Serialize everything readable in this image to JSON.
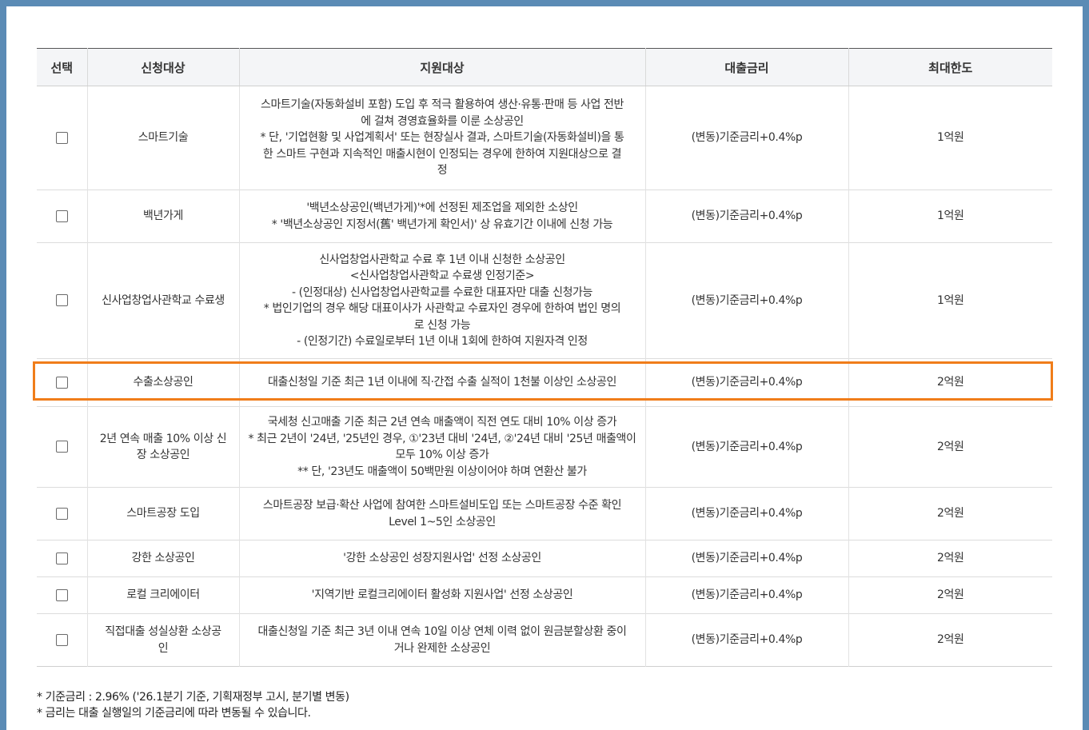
{
  "table": {
    "headers": {
      "select": "선택",
      "target": "신청대상",
      "support": "지원대상",
      "rate": "대출금리",
      "limit": "최대한도"
    },
    "rows": [
      {
        "target": [
          "스마트기술"
        ],
        "support": [
          "스마트기술(자동화설비 포함) 도입 후 적극 활용하여 생산·유통·판매 등 사업 전반",
          "에 걸쳐 경영효율화를 이룬 소상공인",
          "* 단, '기업현황 및 사업계획서' 또는 현장실사 결과, 스마트기술(자동화설비)을 통",
          "한 스마트 구현과 지속적인 매출시현이 인정되는 경우에 한하여 지원대상으로 결",
          "정"
        ],
        "rate": "(변동)기준금리+0.4%p",
        "limit": "1억원"
      },
      {
        "target": [
          "백년가게"
        ],
        "support": [
          "'백년소상공인(백년가게)'*에 선정된 제조업을 제외한 소상인",
          "* '백년소상공인 지정서(舊' 백년가게 확인서)' 상 유효기간 이내에 신청 가능"
        ],
        "rate": "(변동)기준금리+0.4%p",
        "limit": "1억원"
      },
      {
        "target": [
          "신사업창업사관학교 수료생"
        ],
        "support": [
          "신사업창업사관학교 수료 후 1년 이내 신청한 소상공인",
          "<신사업창업사관학교 수료생 인정기준>",
          "- (인정대상) 신사업창업사관학교를 수료한 대표자만 대출 신청가능",
          "* 법인기업의 경우 해당 대표이사가 사관학교 수료자인 경우에 한하여 법인 명의",
          "로 신청 가능",
          "- (인정기간) 수료일로부터 1년 이내 1회에 한하여 지원자격 인정"
        ],
        "rate": "(변동)기준금리+0.4%p",
        "limit": "1억원"
      },
      {
        "target": [
          "수출소상공인"
        ],
        "support": [
          "대출신청일 기준 최근 1년 이내에 직·간접 수출 실적이 1천불 이상인 소상공인"
        ],
        "rate": "(변동)기준금리+0.4%p",
        "limit": "2억원"
      },
      {
        "target": [
          "2년 연속 매출 10% 이상 신",
          "장 소상공인"
        ],
        "support": [
          "국세청 신고매출 기준 최근 2년 연속 매출액이 직전 연도 대비 10% 이상 증가",
          "* 최근 2년이 '24년, '25년인 경우, ①'23년 대비 '24년, ②'24년 대비 '25년 매출액이",
          "모두 10% 이상 증가",
          "** 단, '23년도 매출액이 50백만원 이상이어야 하며 연환산 불가"
        ],
        "rate": "(변동)기준금리+0.4%p",
        "limit": "2억원"
      },
      {
        "target": [
          "스마트공장 도입"
        ],
        "support": [
          "스마트공장 보급·확산 사업에 참여한 스마트설비도입 또는 스마트공장 수준 확인",
          "Level 1~5인 소상공인"
        ],
        "rate": "(변동)기준금리+0.4%p",
        "limit": "2억원"
      },
      {
        "target": [
          "강한 소상공인"
        ],
        "support": [
          "'강한 소상공인 성장지원사업' 선정 소상공인"
        ],
        "rate": "(변동)기준금리+0.4%p",
        "limit": "2억원"
      },
      {
        "target": [
          "로컬 크리에이터"
        ],
        "support": [
          "'지역기반 로컬크리에이터 활성화 지원사업' 선정 소상공인"
        ],
        "rate": "(변동)기준금리+0.4%p",
        "limit": "2억원"
      },
      {
        "target": [
          "직접대출 성실상환 소상공",
          "인"
        ],
        "support": [
          "대출신청일 기준 최근 3년 이내 연속 10일 이상 연체 이력 없이 원금분할상환 중이",
          "거나 완제한 소상공인"
        ],
        "rate": "(변동)기준금리+0.4%p",
        "limit": "2억원"
      }
    ]
  },
  "notes": [
    "* 기준금리 : 2.96% ('26.1분기 기준, 기획재정부 고시, 분기별 변동)",
    "* 금리는 대출 실행일의 기준금리에 따라 변동될 수 있습니다."
  ],
  "colors": {
    "frame": "#5b8bb5",
    "header_bg": "#f4f5f7",
    "highlight": "#f07d1a"
  }
}
